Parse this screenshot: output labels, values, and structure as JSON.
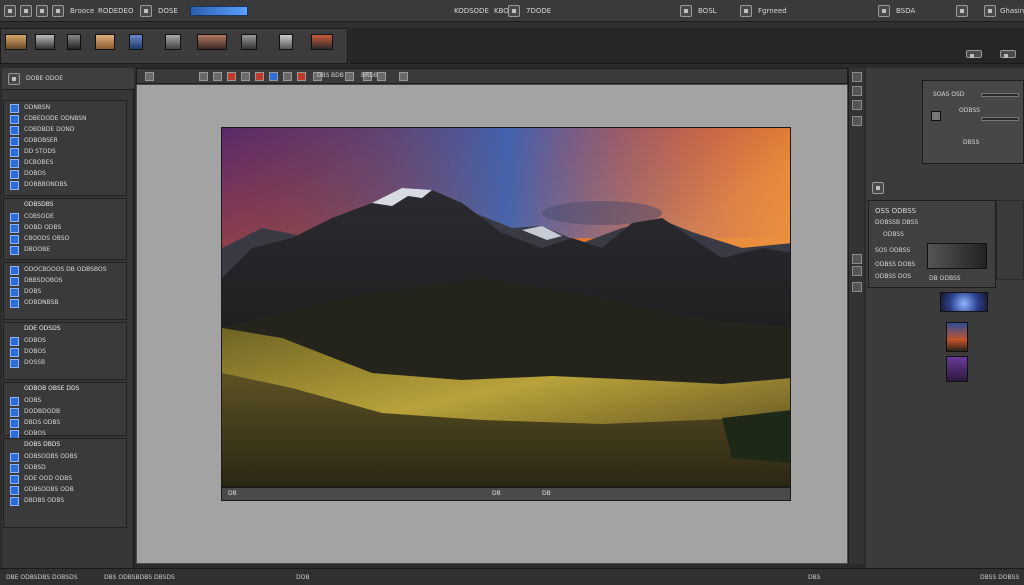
{
  "menubar": {
    "items": [
      "Brooce",
      "RODEDEO",
      "DOSE",
      "7DODE",
      "BOSL",
      "Fgrneed",
      "BSDA",
      "Ghasinerio"
    ],
    "top_labels": [
      "KODSODE",
      "KBODE"
    ]
  },
  "filmstrip": {
    "thumbs": [
      "",
      "",
      "",
      "",
      "",
      "",
      "",
      "",
      "",
      "",
      ""
    ]
  },
  "toolstrip": {
    "labels": [
      "BDB",
      "DBS",
      "BRDB"
    ]
  },
  "left_panel": {
    "header": "DOBE ODOE",
    "sections": [
      {
        "title": "",
        "items": [
          "ODNBSN",
          "CDBEDODE ODNBSN",
          "COBDBDE DOND",
          "ODBOBSER",
          "DD STODS",
          "DCBOBES",
          "DOBOS",
          "DOBBBONDBS"
        ]
      },
      {
        "title": "ODBSDBS",
        "items": [
          "COBSODE",
          "OOBD ODBS",
          "CBOODS OBSO",
          "DBOOBE"
        ]
      },
      {
        "title": "",
        "items": [
          "ODOCBOOOS DB ODBSBOS",
          "DBBSDOBOS",
          "DOBS",
          "ODBDNBSB"
        ]
      },
      {
        "title": "DDE ODSDS",
        "items": [
          "ODBOS",
          "DOBOS",
          "DOSSB"
        ]
      },
      {
        "title": "ODBOB OBSE DDS",
        "items": [
          "ODBS",
          "DODBDODB",
          "DBDS ODBS",
          "ODBOS"
        ]
      },
      {
        "title": "DOBS DBDS",
        "items": [
          "ODBSODBS ODBS",
          "ODBSD",
          "DDE OOD ODBS",
          "ODBSODBS ODB",
          "DBDBS ODBS"
        ]
      }
    ]
  },
  "photo_bar": {
    "labels": [
      "DB",
      "DB",
      "DB"
    ]
  },
  "right_panel": {
    "nav_title": "SOAS OSD",
    "nav_value": "ODBSS",
    "nav_label2": "DBSS",
    "props_title": "OSS ODBSS",
    "props_rows": [
      "DOBSSB DBSS",
      "ODBSS",
      "SOS ODBSS",
      "ODBSS DOBS",
      "ODBSS DOS"
    ],
    "props_tag": "DB ODBSS"
  },
  "statusbar": {
    "labels": [
      "DBE ODBSDBS DOBSDS",
      "DBS ODBSBDBS DBSDS",
      "DOB",
      "DBS",
      "DBSS DOBSS"
    ]
  },
  "colors": {
    "accent_blue": "#2e6fd8",
    "panel_bg": "#363636",
    "workspace_bg": "#a3a3a3"
  }
}
